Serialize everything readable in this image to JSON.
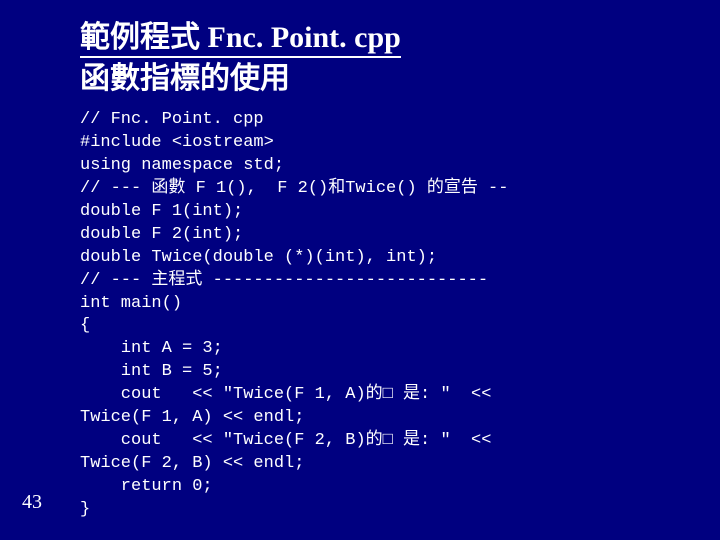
{
  "slide": {
    "title_line1": "範例程式 Fnc. Point. cpp",
    "title_line2": "函數指標的使用",
    "page_number": "43"
  },
  "code": {
    "l01": "// Fnc. Point. cpp",
    "l02": "#include <iostream>",
    "l03": "using namespace std;",
    "l04": "// --- 函數 F 1(),  F 2()和Twice() 的宣告 --",
    "l05": "double F 1(int);",
    "l06": "double F 2(int);",
    "l07": "double Twice(double (*)(int), int);",
    "l08": "// --- 主程式 ---------------------------",
    "l09": "int main()",
    "l10": "{",
    "l11": "    int A = 3;",
    "l12": "    int B = 5;",
    "l13": "    cout   << \"Twice(F 1, A)的□ 是: \"  <<",
    "l14": "Twice(F 1, A) << endl;",
    "l15": "    cout   << \"Twice(F 2, B)的□ 是: \"  <<",
    "l16": "Twice(F 2, B) << endl;",
    "l17": "    return 0;",
    "l18": "}"
  }
}
